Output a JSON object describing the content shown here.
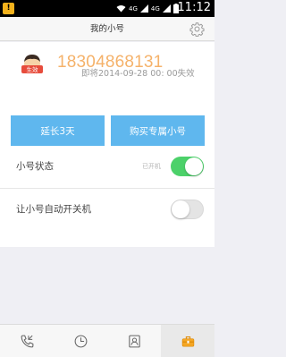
{
  "status_bar": {
    "time": "11:12",
    "network_1": "4G",
    "network_2": "4G"
  },
  "nav": {
    "title": "我的小号"
  },
  "card": {
    "avatar_label": "生效",
    "phone_number": "18304868131",
    "expire_text": "即将2014-09-28 00: 00失效",
    "extend_button": "延长3天",
    "buy_button": "购买专属小号"
  },
  "settings": {
    "status_label": "小号状态",
    "status_value": "已开机",
    "status_on": true,
    "auto_power_label": "让小号自动开关机",
    "auto_power_on": false
  },
  "tabs": [
    {
      "icon": "phone-icon"
    },
    {
      "icon": "clock-icon"
    },
    {
      "icon": "contacts-icon"
    },
    {
      "icon": "toolbox-icon"
    }
  ],
  "colors": {
    "accent_blue": "#5fb7ee",
    "number_orange": "#f5b26a",
    "toggle_green": "#4cd16a",
    "avatar_red": "#e74c3c"
  }
}
